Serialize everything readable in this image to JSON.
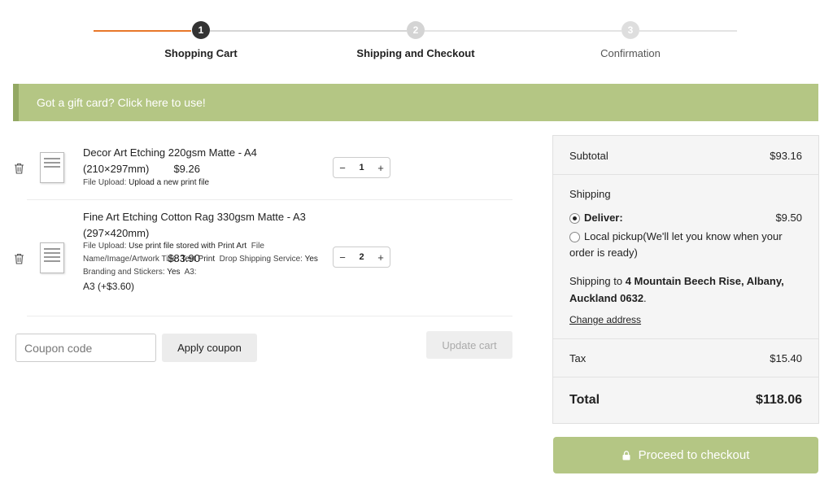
{
  "stepper": {
    "steps": [
      {
        "number": "1",
        "label": "Shopping Cart"
      },
      {
        "number": "2",
        "label": "Shipping and Checkout"
      },
      {
        "number": "3",
        "label": "Confirmation"
      }
    ],
    "accent_color": "#e8782a"
  },
  "gift_banner": {
    "text": "Got a gift card? Click here to use!",
    "color": "#b4c684"
  },
  "cart": {
    "items": [
      {
        "title_line1": "Decor Art Etching 220gsm Matte - A4",
        "title_line2": "(210×297mm)",
        "meta_label": "File Upload:",
        "meta_value": "Upload a new print file",
        "quantity": "1",
        "price": "$9.26",
        "thumb_icon": "print-thumbnail"
      },
      {
        "title_line1": "Fine Art Etching Cotton Rag 330gsm Matte  - A3",
        "title_line2": "(297×420mm)",
        "meta": [
          {
            "label": "File Upload:",
            "value": "Use print file stored with Print Art"
          },
          {
            "label": "File Name/Image/Artwork Title:",
            "value": "Test Print"
          },
          {
            "label": "Drop Shipping Service:",
            "value": "Yes"
          },
          {
            "label": "Branding and Stickers:",
            "value": "Yes"
          },
          {
            "label": "A3:",
            "value": "A3 (+$3.60)"
          }
        ],
        "quantity": "2",
        "price": "$83.90",
        "thumb_icon": "print-thumbnail"
      }
    ],
    "qty_minus": "−",
    "qty_plus": "+"
  },
  "coupon": {
    "placeholder": "Coupon code",
    "apply_label": "Apply coupon",
    "update_label": "Update cart"
  },
  "summary": {
    "subtotal_label": "Subtotal",
    "subtotal_value": "$93.16",
    "shipping_label": "Shipping",
    "deliver_label": "Deliver:",
    "deliver_price": "$9.50",
    "pickup_label": "Local pickup(We'll let you know when your order is ready)",
    "shipping_to_prefix": "Shipping to",
    "shipping_address": "4 Mountain Beech Rise, Albany, Auckland 0632",
    "change_address": "Change address",
    "tax_label": "Tax",
    "tax_value": "$15.40",
    "total_label": "Total",
    "total_value": "$118.06"
  },
  "checkout": {
    "label": "Proceed to checkout",
    "icon": "lock-icon",
    "color": "#b4c684"
  }
}
